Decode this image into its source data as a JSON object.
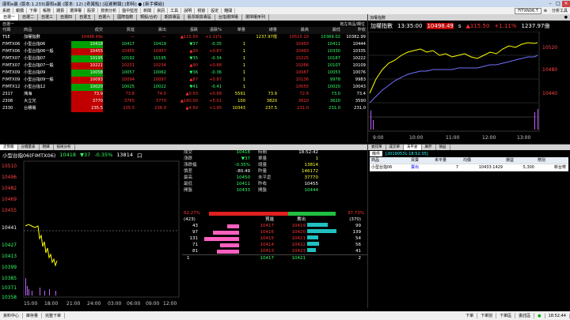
{
  "window": {
    "title": "康和e贏 (版本:1.233)康和e贏 (版本: 12) [奇異點] [延遲開報] [即時] ● [新手模組]",
    "minimize": "–",
    "maximize": "□",
    "close": "×"
  },
  "menu": [
    "系統",
    "報價",
    "下單",
    "帳務",
    "期貨",
    "選擇權",
    "股票",
    "技術分析",
    "盤中監控",
    "新聞",
    "資訊",
    "工具",
    "說明",
    "視窗",
    "設定",
    "離開"
  ],
  "topright_ticker": "FITXN06.T",
  "topright_tools": "⊕",
  "topright_more": "分析工具",
  "tabs1": [
    "自選一",
    "自選二",
    "自選三",
    "自選四",
    "自選五",
    "自選六",
    "國際指數",
    "類股/合約",
    "期貨專區",
    "股票期貨專區",
    "台指選擇權",
    "選擇權序列",
    "大盤走勢",
    "個股全覽",
    "個股走勢圖",
    "技術分析"
  ],
  "sub1": {
    "left": "自選一",
    "right": "拖左商品/欄位"
  },
  "quote_headers": [
    "代碼",
    "商品",
    "成交",
    "買進",
    "賣出",
    "漲跌",
    "漲跌%",
    "單量",
    "總量",
    "最高",
    "最低",
    "昨收"
  ],
  "quote_extra_headers": [
    "",
    "開盤"
  ],
  "quote_rows": [
    [
      "TSE",
      "加權指數",
      "10498.49s",
      "—",
      "—",
      "▲115.50",
      "+1.11%",
      "",
      "1237.97億",
      "10515.10",
      "10369.02",
      "10382.99",
      "957.22"
    ],
    [
      "FIMTX06",
      "小型台指06",
      "10418",
      "10417",
      "10419",
      "▼37",
      "-0.35",
      "1",
      "",
      "10450",
      "10411",
      "10444",
      "14617"
    ],
    [
      "FIMTX06",
      "小型台指06一般",
      "10455",
      "10455",
      "10457",
      "▲30",
      "+0.87",
      "1",
      "",
      "10493",
      "10330",
      "10335",
      "103043"
    ],
    [
      "FIMTX07",
      "小型台指07",
      "10195",
      "10192",
      "10195",
      "▼35",
      "-0.34",
      "1",
      "",
      "10225",
      "10187",
      "10222",
      "5044"
    ],
    [
      "FIMTX07",
      "小型台指07一般",
      "10221",
      "10231",
      "10234",
      "▲90",
      "+0.88",
      "1",
      "",
      "10266",
      "10107",
      "10109",
      "3089"
    ],
    [
      "FIMTX09",
      "小型台指09",
      "10058",
      "10057",
      "10062",
      "▼36",
      "-0.36",
      "1",
      "",
      "10087",
      "10053",
      "10076",
      "453"
    ],
    [
      "FIMTX09",
      "小型台指09一般",
      "10093",
      "10094",
      "10097",
      "▲87",
      "+0.87",
      "1",
      "",
      "10136",
      "9978",
      "9983",
      "10008"
    ],
    [
      "FIMTX12",
      "小型台指12",
      "10020",
      "10025",
      "10022",
      "▼41",
      "-0.41",
      "1",
      "",
      "10055",
      "10020",
      "10043",
      "10061"
    ],
    [
      "2317",
      "鴻海",
      "73.9",
      "73.8",
      "74.0",
      "▲0.50",
      "+0.68",
      "5591",
      "73.9",
      "72.8",
      "73.0",
      "73.4",
      "44881"
    ],
    [
      "2308",
      "大立光",
      "3770",
      "3765",
      "3770",
      "▲180.00",
      "+5.01",
      "100",
      "3820",
      "3620",
      "3620",
      "3590",
      "766"
    ],
    [
      "2330",
      "台積電",
      "235.5",
      "235.5",
      "236.0",
      "▲4.50",
      "+1.95",
      "10343",
      "237.5",
      "231.0",
      "231.0",
      "231.0",
      "40375"
    ]
  ],
  "index_panel": {
    "tab": "加權指數",
    "tab_right": "●",
    "name": "加權指數",
    "time": "13:35:00",
    "price": "10498.49",
    "flag": "s",
    "change": "▲115.50",
    "pct": "+1.11%",
    "vol": "1237.97億",
    "yticks": [
      "10520",
      "10480",
      "10440"
    ],
    "xticks": [
      "9:00",
      "10:00",
      "11:00",
      "12:00",
      "13:00"
    ]
  },
  "bl_tabs": [
    "走勢圖",
    "分價量表",
    "明細",
    "技術分析"
  ],
  "bl": {
    "name": "小型台指06(FIMTX06)",
    "price": "10418",
    "chg": "▼37",
    "pct": "-0.35%",
    "vol": "13814",
    "sym": "口",
    "yticks": [
      "10510",
      "10496",
      "10482",
      "10469",
      "10455",
      "10441",
      "10427",
      "10413",
      "10399",
      "10385",
      "10371",
      "10358"
    ],
    "xticks": [
      "15:00",
      "18:00",
      "21:00",
      "24:00",
      "03:00",
      "06:00",
      "09:00",
      "12:00"
    ]
  },
  "detail_left": [
    [
      "成交",
      "10418"
    ],
    [
      "漲跌",
      "▼37"
    ],
    [
      "漲跌幅",
      "-0.35%"
    ],
    [
      "價差",
      "-80.49"
    ],
    [
      "最高",
      "10450"
    ],
    [
      "最低",
      "10411"
    ],
    [
      "開盤",
      "10433"
    ]
  ],
  "detail_right": [
    [
      "時間",
      "18:52:42"
    ],
    [
      "單量",
      "1"
    ],
    [
      "總量",
      "13814"
    ],
    [
      "昨量",
      "146172"
    ],
    [
      "未平倉",
      "37770"
    ],
    [
      "昨收",
      "10455"
    ],
    [
      "開盤",
      "10444"
    ]
  ],
  "book": {
    "buy_pct": "62.27%",
    "sell_pct": "37.73%",
    "buy_total": "(423)",
    "sell_total": "(370)",
    "hdr_bid": "買進",
    "hdr_ask": "賣出",
    "rows": [
      {
        "bq": "43",
        "bp": "10417",
        "ap": "10419",
        "aq": "99",
        "bw": 0.28,
        "aw": 0.55
      },
      {
        "bq": "97",
        "bp": "10416",
        "ap": "10420",
        "aq": "139",
        "bw": 0.63,
        "aw": 0.78
      },
      {
        "bq": "131",
        "bp": "10415",
        "ap": "10421",
        "aq": "54",
        "bw": 0.85,
        "aw": 0.3
      },
      {
        "bq": "71",
        "bp": "10414",
        "ap": "10422",
        "aq": "56",
        "bw": 0.46,
        "aw": 0.31
      },
      {
        "bq": "81",
        "bp": "10413",
        "ap": "10423",
        "aq": "41",
        "bw": 0.53,
        "aw": 0.23
      }
    ],
    "foot": {
      "q": "1",
      "bp": "10417",
      "ap": "10421",
      "aq": "2"
    }
  },
  "rb_tabs": [
    "委託單",
    "成交單",
    "未平倉",
    "庫存",
    "損益"
  ],
  "rb_filter": {
    "label": "條件",
    "value": "[20190531-18:52:35]"
  },
  "order_headers": [
    "商品",
    "買賣",
    "未平量",
    "均價",
    "損益",
    "幣別"
  ],
  "order_row": [
    "小型台指06",
    "賣出",
    "7",
    "10433.1429",
    "5,300",
    "新台幣"
  ],
  "status": [
    "資料中心",
    "庫存量",
    "完整下單",
    "",
    "",
    "",
    "",
    "",
    "",
    "",
    "",
    "",
    "",
    "",
    "",
    "",
    "",
    "",
    "",
    "下單",
    "下單別",
    "下單區",
    "委託區",
    "●",
    "18:52:44"
  ]
}
